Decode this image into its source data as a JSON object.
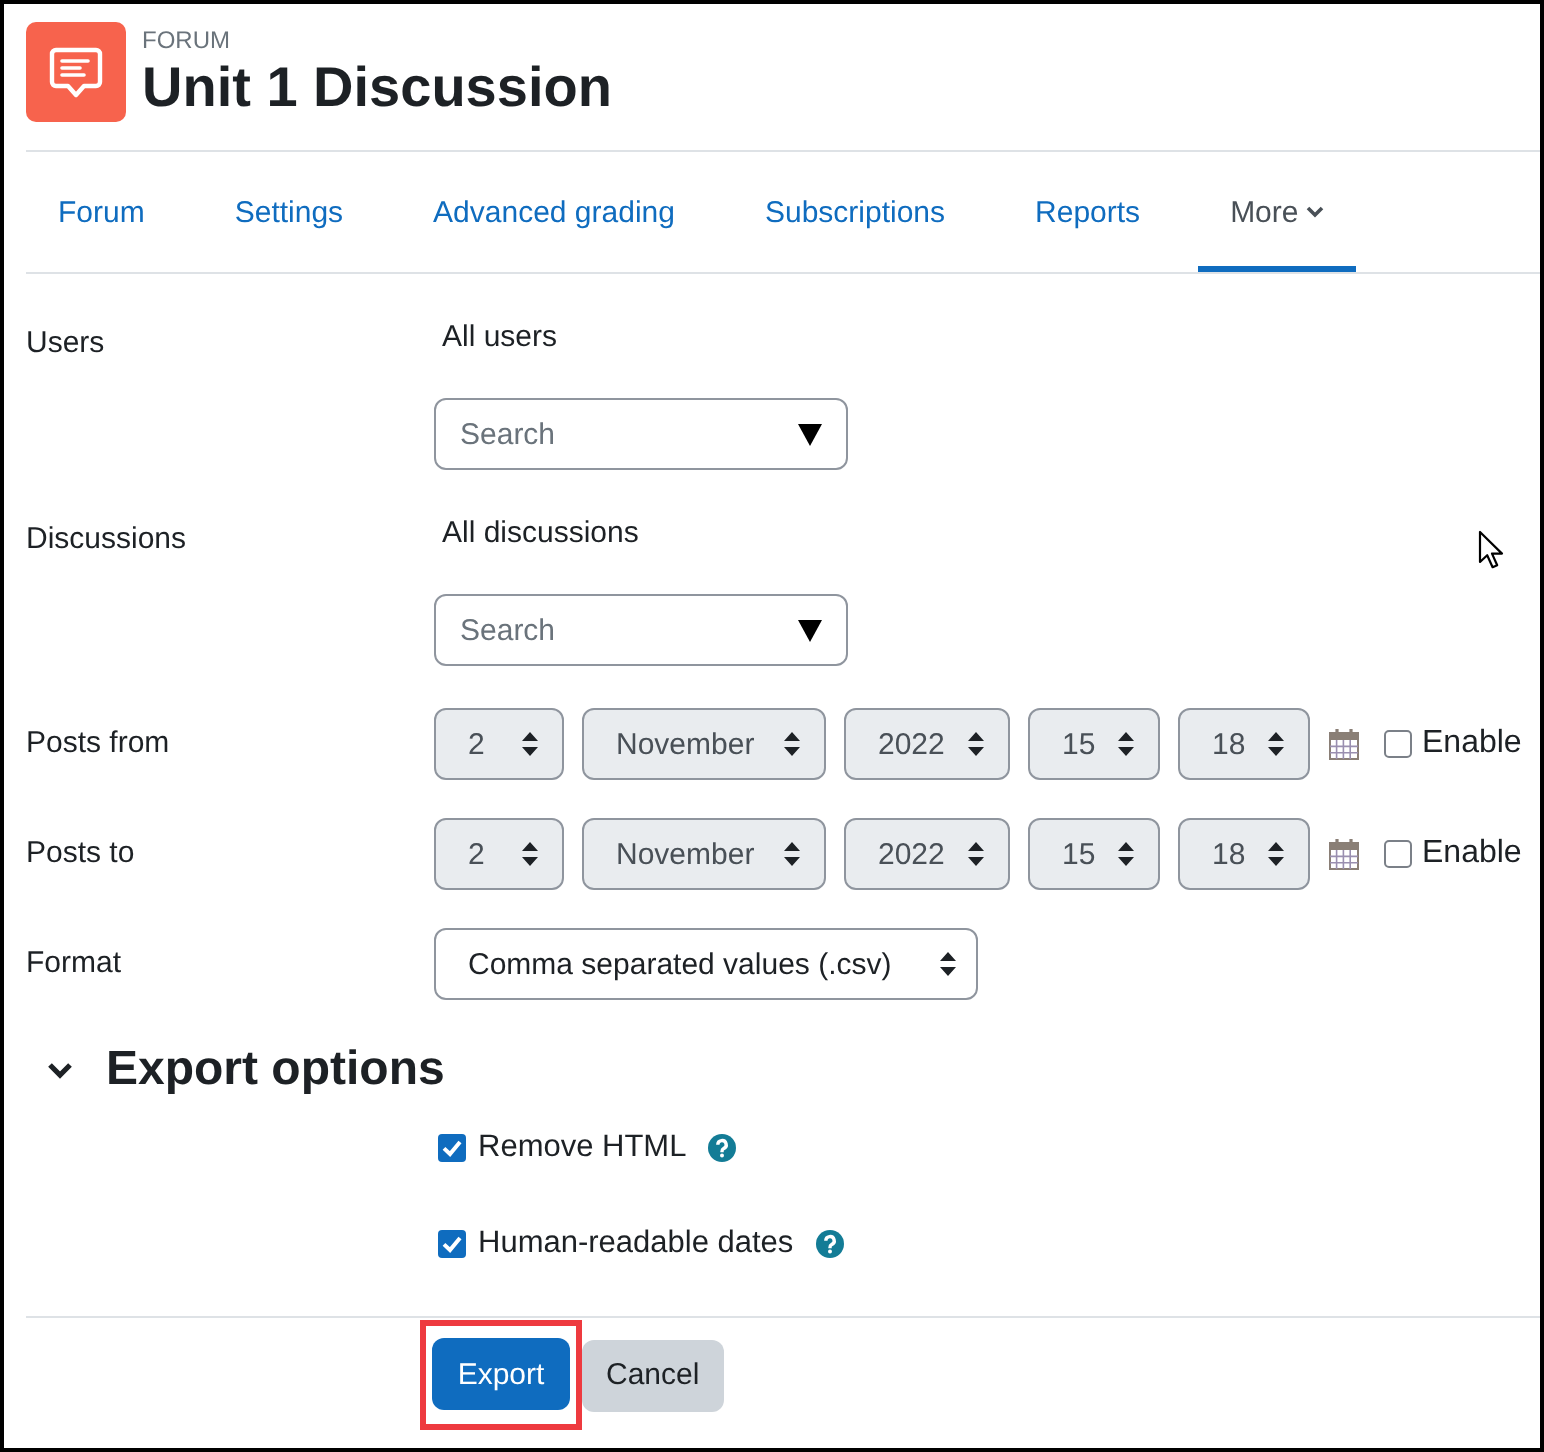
{
  "header": {
    "category": "FORUM",
    "title": "Unit 1 Discussion"
  },
  "tabs": [
    {
      "label": "Forum",
      "selected": false,
      "kind": "link"
    },
    {
      "label": "Settings",
      "selected": false,
      "kind": "link"
    },
    {
      "label": "Advanced grading",
      "selected": false,
      "kind": "link"
    },
    {
      "label": "Subscriptions",
      "selected": false,
      "kind": "link"
    },
    {
      "label": "Reports",
      "selected": false,
      "kind": "link"
    },
    {
      "label": "More",
      "selected": true,
      "kind": "menu"
    }
  ],
  "form": {
    "rows": [
      {
        "kind": "autocomplete",
        "label": "Users",
        "selection": "All users",
        "placeholder": "Search"
      },
      {
        "kind": "autocomplete",
        "label": "Discussions",
        "selection": "All discussions",
        "placeholder": "Search"
      },
      {
        "kind": "date_time",
        "label": "Posts from",
        "fields": [
          "2",
          "November",
          "2022",
          "15",
          "18"
        ],
        "enable": {
          "label": "Enable",
          "checked": false
        }
      },
      {
        "kind": "date_time",
        "label": "Posts to",
        "fields": [
          "2",
          "November",
          "2022",
          "15",
          "18"
        ],
        "enable": {
          "label": "Enable",
          "checked": false
        }
      },
      {
        "kind": "select",
        "label": "Format",
        "value": "Comma separated values (.csv)"
      }
    ]
  },
  "export_options": {
    "title": "Export options",
    "expanded": true,
    "options": [
      {
        "label": "Remove HTML",
        "checked": true
      },
      {
        "label": "Human-readable dates",
        "checked": true
      }
    ]
  },
  "buttons": [
    {
      "label": "Export",
      "kind": "primary",
      "highlighted": true
    },
    {
      "label": "Cancel",
      "kind": "secondary",
      "highlighted": false
    }
  ]
}
